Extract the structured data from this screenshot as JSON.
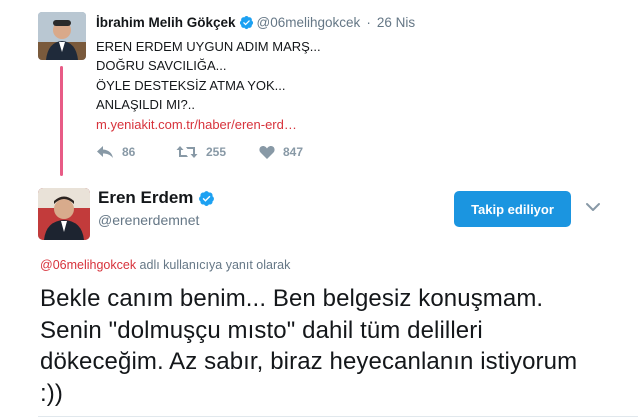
{
  "parent_tweet": {
    "name": "İbrahim Melih Gökçek",
    "handle": "@06melihgokcek",
    "separator": "·",
    "date": "26 Nis",
    "text_lines": [
      "EREN ERDEM UYGUN ADIM MARŞ...",
      "DOĞRU SAVCILIĞA...",
      "ÖYLE DESTEKSİZ ATMA YOK...",
      "ANLAŞILDI MI?.."
    ],
    "link": "m.yeniakit.com.tr/haber/eren-erd…",
    "replies": "86",
    "retweets": "255",
    "likes": "847"
  },
  "main_tweet": {
    "name": "Eren Erdem",
    "handle": "@erenerdemnet",
    "follow_label": "Takip ediliyor",
    "reply_mention": "@06melihgokcek",
    "reply_suffix": " adlı kullanıcıya yanıt olarak",
    "text": "Bekle canım benim... Ben belgesiz konuşmam. Senin \"dolmuşçu mısto\" dahil tüm delilleri dökeceğim. Az sabır, biraz heyecanlanın istiyorum :))"
  },
  "colors": {
    "accent": "#1b95e0",
    "link": "#d7333c",
    "thread_line": "#e0245e",
    "muted": "#657786"
  },
  "icons": [
    "verified-badge-icon",
    "reply-icon",
    "retweet-icon",
    "heart-icon",
    "chevron-down-icon"
  ]
}
